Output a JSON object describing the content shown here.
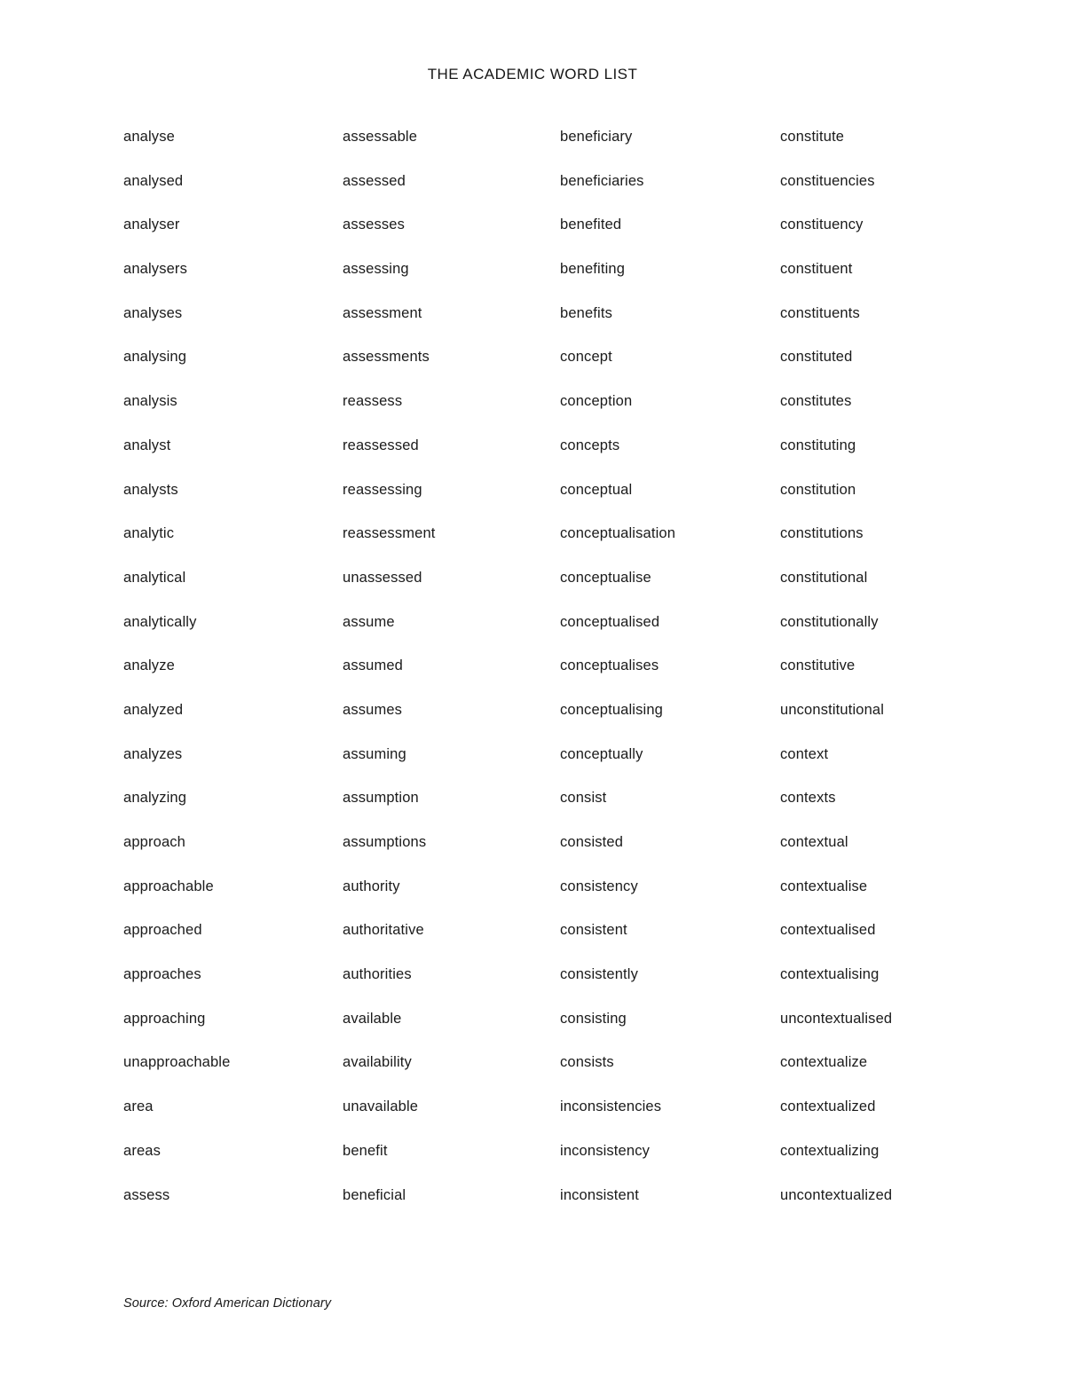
{
  "document": {
    "title": "THE ACADEMIC WORD LIST",
    "source_note": "Source: Oxford American Dictionary"
  },
  "columns": [
    {
      "index": 1,
      "words": [
        "analyse",
        "analysed",
        "analyser",
        "analysers",
        "analyses",
        "analysing",
        "analysis",
        "analyst",
        "analysts",
        "analytic",
        "analytical",
        "analytically",
        "analyze",
        "analyzed",
        "analyzes",
        "analyzing",
        "approach",
        "approachable",
        "approached",
        "approaches",
        "approaching",
        "unapproachable",
        "area",
        "areas",
        "assess"
      ]
    },
    {
      "index": 2,
      "words": [
        "assessable",
        "assessed",
        "assesses",
        "assessing",
        "assessment",
        "assessments",
        "reassess",
        "reassessed",
        "reassessing",
        "reassessment",
        "unassessed",
        "assume",
        "assumed",
        "assumes",
        "assuming",
        "assumption",
        "assumptions",
        "authority",
        "authoritative",
        "authorities",
        "available",
        "availability",
        "unavailable",
        "benefit",
        "beneficial"
      ]
    },
    {
      "index": 3,
      "words": [
        "beneficiary",
        "beneficiaries",
        "benefited",
        "benefiting",
        "benefits",
        "concept",
        "conception",
        "concepts",
        "conceptual",
        "conceptualisation",
        "conceptualise",
        "conceptualised",
        "conceptualises",
        "conceptualising",
        "conceptually",
        "consist",
        "consisted",
        "consistency",
        "consistent",
        "consistently",
        "consisting",
        "consists",
        "inconsistencies",
        "inconsistency",
        "inconsistent"
      ]
    },
    {
      "index": 4,
      "words": [
        "constitute",
        "constituencies",
        "constituency",
        "constituent",
        "constituents",
        "constituted",
        "constitutes",
        "constituting",
        "constitution",
        "constitutions",
        "constitutional",
        "constitutionally",
        "constitutive",
        "unconstitutional",
        "context",
        "contexts",
        "contextual",
        "contextualise",
        "contextualised",
        "contextualising",
        "uncontextualised",
        "contextualize",
        "contextualized",
        "contextualizing",
        "uncontextualized"
      ]
    }
  ]
}
